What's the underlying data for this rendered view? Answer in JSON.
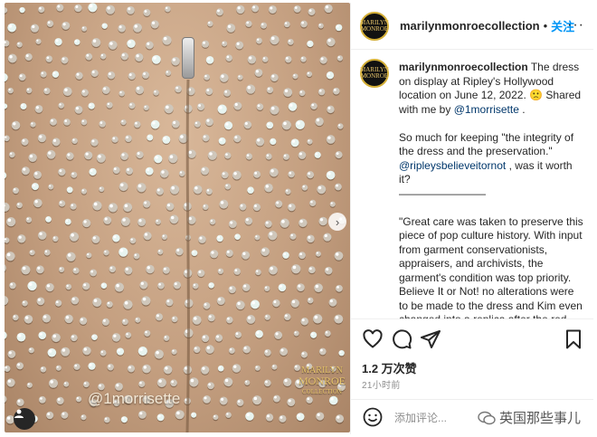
{
  "post": {
    "username": "marilynmonroecollection",
    "follow_label": "关注",
    "more_label": "···",
    "avatar_text": "MARILYN MONROE",
    "photo": {
      "watermark": "@1morrisette",
      "logo_line1": "MARILYN",
      "logo_line2": "MONROE",
      "logo_line3": "COLLECTION",
      "next_label": "›"
    },
    "caption": {
      "username": "marilynmonroecollection",
      "line1": " The dress on display at Ripley's Hollywood location on June 12, 2022. 🙁 Shared with me by ",
      "mention1": "@1morrisette",
      "line1_end": " .",
      "para2_start": "So much for keeping \"the integrity of the dress and the preservation.\" ",
      "mention2": "@ripleysbelieveitornot",
      "para2_end": " , was it worth it?",
      "divider": "————————",
      "para3": "\"Great care was taken to preserve this piece of pop culture history. With input from garment conservationists, appraisers, and archivists, the garment's condition was top priority. Believe It or Not! no alterations were to be made to the dress and Kim even changed into a replica after the red carpet!\""
    },
    "likes": "1.2 万次赞",
    "time": "21小时前",
    "comment_placeholder": "添加评论...",
    "source_label": "英国那些事儿"
  }
}
